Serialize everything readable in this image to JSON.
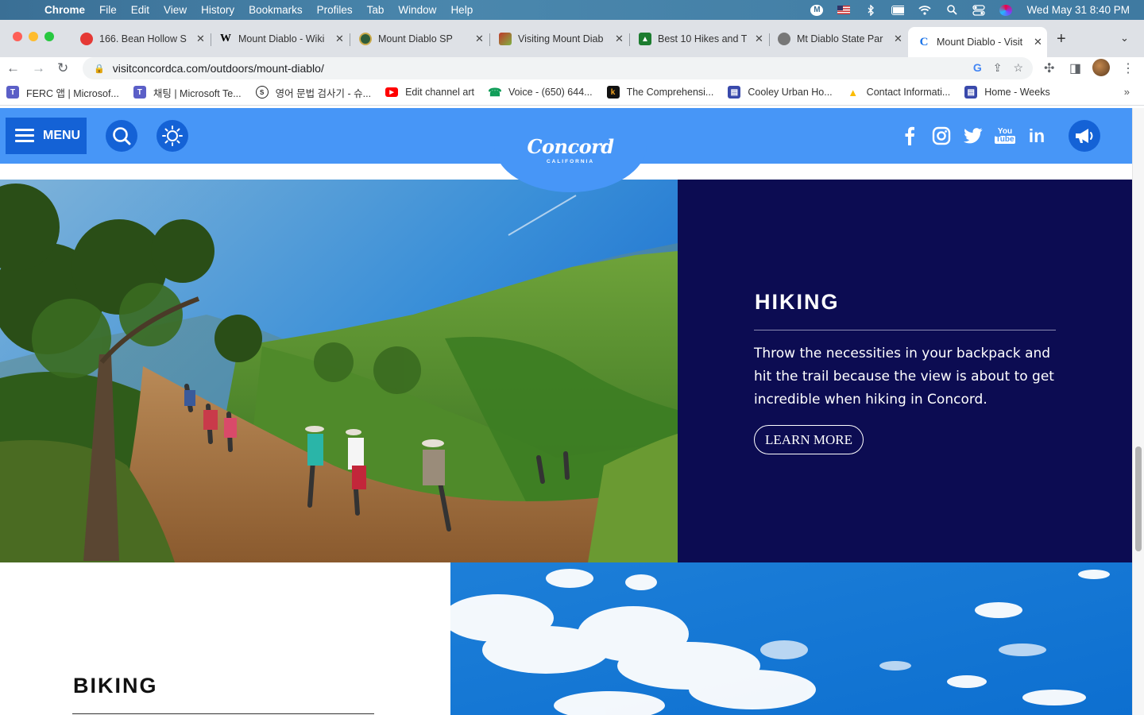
{
  "macos": {
    "app": "Chrome",
    "menus": [
      "File",
      "Edit",
      "View",
      "History",
      "Bookmarks",
      "Profiles",
      "Tab",
      "Window",
      "Help"
    ],
    "clock": "Wed May 31  8:40 PM"
  },
  "tabs": [
    {
      "title": "166. Bean Hollow S",
      "color": "#e53935"
    },
    {
      "title": "Mount Diablo - Wiki",
      "color": "#000000"
    },
    {
      "title": "Mount Diablo SP",
      "color": "#2e5d3a"
    },
    {
      "title": "Visiting Mount Diab",
      "color": "#c0392b"
    },
    {
      "title": "Best 10 Hikes and T",
      "color": "#1c7c2f"
    },
    {
      "title": "Mt Diablo State Par",
      "color": "#555555"
    },
    {
      "title": "Mount Diablo - Visit",
      "color": "#1a73e8"
    }
  ],
  "address": {
    "url": "visitconcordca.com/outdoors/mount-diablo/"
  },
  "bookmarks": [
    {
      "label": "FERC 앱 | Microsof...",
      "color": "#5b5fc7",
      "glyph": "T"
    },
    {
      "label": "채팅 | Microsoft Te...",
      "color": "#5b5fc7",
      "glyph": "T"
    },
    {
      "label": "영어 문법 검사기 - 슈...",
      "color": "#222222",
      "glyph": "S"
    },
    {
      "label": "Edit channel art",
      "color": "#ff0000",
      "glyph": "▶"
    },
    {
      "label": "Voice - (650) 644...",
      "color": "#0f9d58",
      "glyph": "☎"
    },
    {
      "label": "The Comprehensi...",
      "color": "#111111",
      "glyph": "k"
    },
    {
      "label": "Cooley Urban Ho...",
      "color": "#3949ab",
      "glyph": "▤"
    },
    {
      "label": "Contact Informati...",
      "color": "#fbbc04",
      "glyph": "▲"
    },
    {
      "label": "Home - Weeks",
      "color": "#3949ab",
      "glyph": "▤"
    }
  ],
  "site": {
    "menu_label": "MENU",
    "logo": {
      "name": "Concord",
      "sub": "CALIFORNIA"
    },
    "colors": {
      "header": "#4796f7",
      "button": "#1462d6",
      "panel": "#0c0c52"
    },
    "hiking": {
      "title": "HIKING",
      "description": "Throw the necessities in your backpack and hit the trail because the view is about to get incredible when hiking in Concord.",
      "cta": "LEARN MORE"
    },
    "biking": {
      "title": "BIKING"
    }
  }
}
